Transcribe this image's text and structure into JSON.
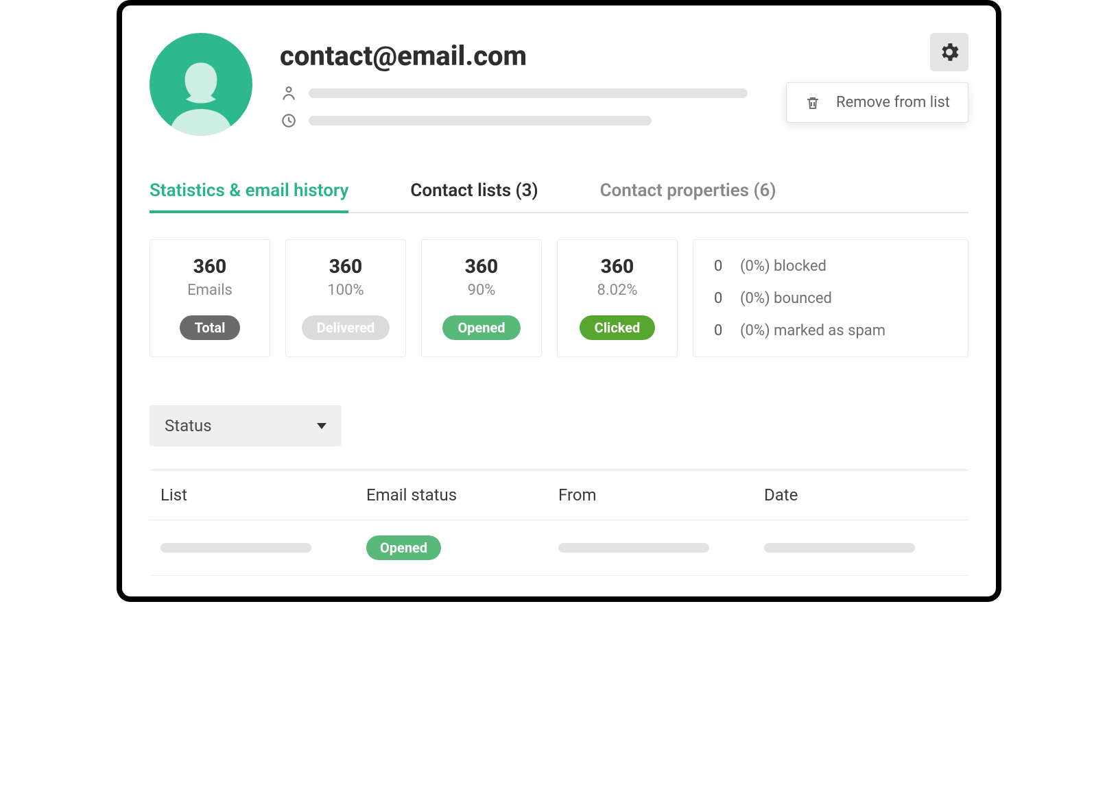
{
  "header": {
    "title": "contact@email.com"
  },
  "menu": {
    "remove_label": "Remove from list"
  },
  "tabs": {
    "stats": "Statistics & email history",
    "lists": "Contact lists (3)",
    "properties": "Contact properties (6)"
  },
  "stats": {
    "total": {
      "count": "360",
      "sub": "Emails",
      "pill": "Total"
    },
    "delivered": {
      "count": "360",
      "sub": "100%",
      "pill": "Delivered"
    },
    "opened": {
      "count": "360",
      "sub": "90%",
      "pill": "Opened"
    },
    "clicked": {
      "count": "360",
      "sub": "8.02%",
      "pill": "Clicked"
    }
  },
  "negatives": {
    "blocked": {
      "count": "0",
      "text": "(0%) blocked"
    },
    "bounced": {
      "count": "0",
      "text": "(0%) bounced"
    },
    "spam": {
      "count": "0",
      "text": "(0%) marked as spam"
    }
  },
  "filter": {
    "status_label": "Status"
  },
  "table": {
    "headers": {
      "list": "List",
      "status": "Email status",
      "from": "From",
      "date": "Date"
    },
    "row0_status": "Opened"
  }
}
